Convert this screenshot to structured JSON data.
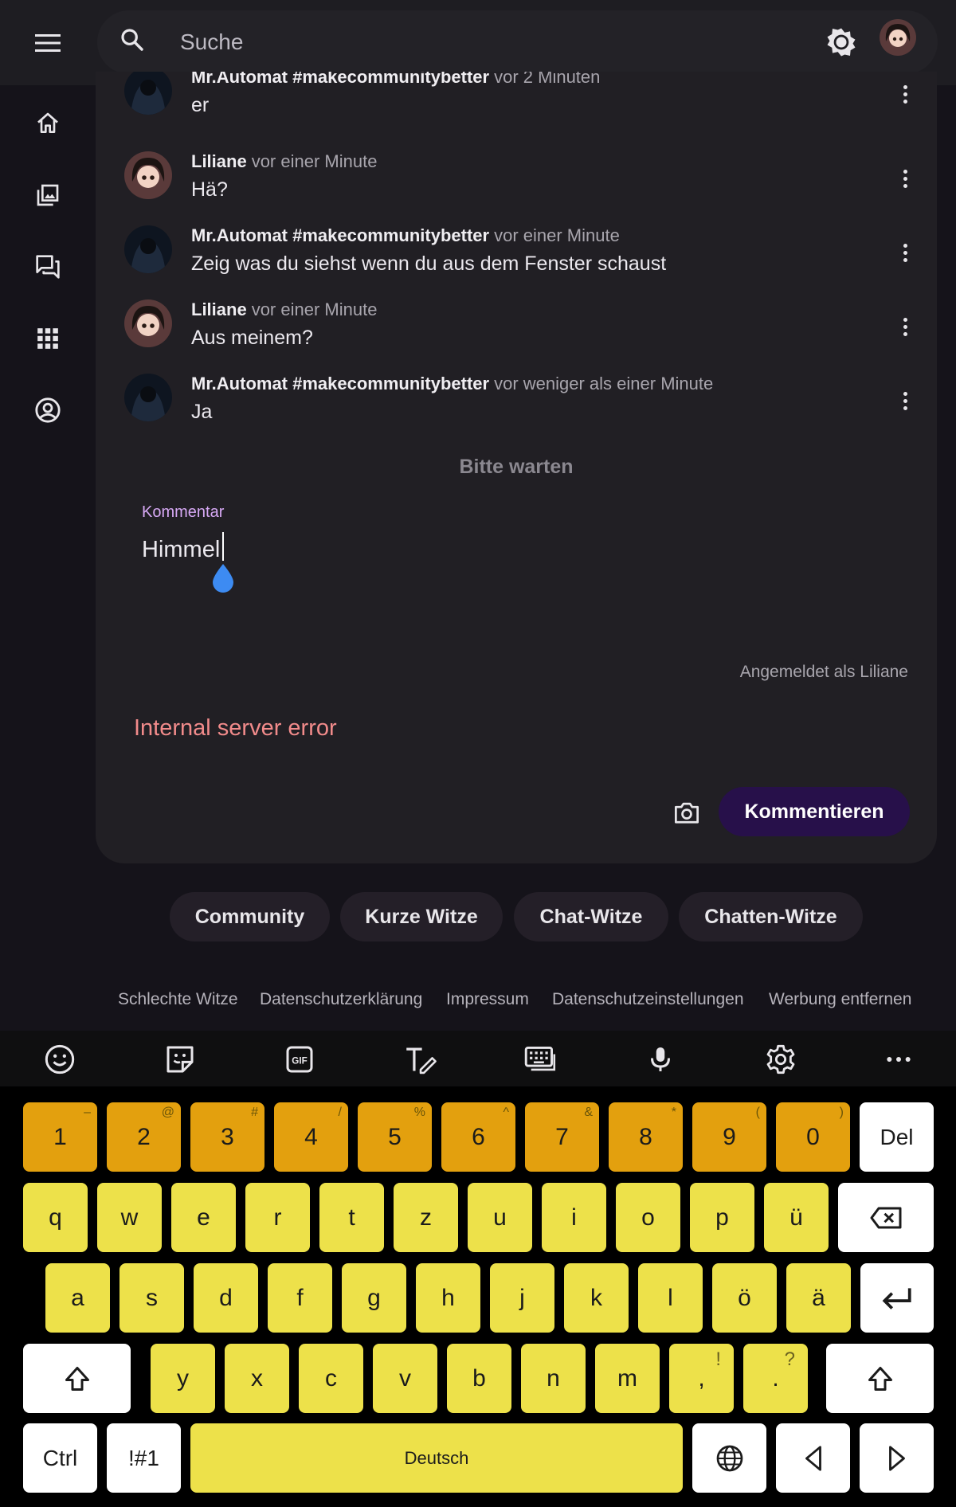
{
  "header": {
    "search_placeholder": "Suche"
  },
  "comments": [
    {
      "author": "Mr.Automat #makecommunitybetter",
      "time": "vor 2 Minuten",
      "text": "er"
    },
    {
      "author": "Liliane",
      "time": "vor einer Minute",
      "text": "Hä?"
    },
    {
      "author": "Mr.Automat #makecommunitybetter",
      "time": "vor einer Minute",
      "text": "Zeig was du siehst wenn du aus dem Fenster schaust"
    },
    {
      "author": "Liliane",
      "time": "vor einer Minute",
      "text": "Aus meinem?"
    },
    {
      "author": "Mr.Automat #makecommunitybetter",
      "time": "vor weniger als einer Minute",
      "text": "Ja"
    }
  ],
  "composer": {
    "status": "Bitte warten",
    "label": "Kommentar",
    "value": "Himmel",
    "signed_in": "Angemeldet als Liliane",
    "error": "Internal server error",
    "submit": "Kommentieren"
  },
  "chips": [
    "Community",
    "Kurze Witze",
    "Chat-Witze",
    "Chatten-Witze"
  ],
  "footer_links": [
    "Schlechte Witze",
    "Datenschutzerklärung",
    "Impressum",
    "Datenschutzeinstellungen",
    "Werbung entfernen"
  ],
  "keyboard": {
    "numbers": [
      "1",
      "2",
      "3",
      "4",
      "5",
      "6",
      "7",
      "8",
      "9",
      "0"
    ],
    "number_alts": [
      "–",
      "@",
      "#",
      "/",
      "%",
      "^",
      "&",
      "*",
      "(",
      ")"
    ],
    "del": "Del",
    "row1": [
      "q",
      "w",
      "e",
      "r",
      "t",
      "z",
      "u",
      "i",
      "o",
      "p",
      "ü"
    ],
    "row2": [
      "a",
      "s",
      "d",
      "f",
      "g",
      "h",
      "j",
      "k",
      "l",
      "ö",
      "ä"
    ],
    "row3": [
      "y",
      "x",
      "c",
      "v",
      "b",
      "n",
      "m",
      ",",
      "."
    ],
    "row3_alts": [
      "",
      "",
      "",
      "",
      "",
      "",
      "",
      "!",
      "?"
    ],
    "ctrl": "Ctrl",
    "symbols": "!#1",
    "space": "Deutsch"
  },
  "colors": {
    "accent": "#d7a9f5",
    "error": "#f28b8b",
    "submit_bg": "#27104a",
    "key_number": "#e3a00e",
    "key_letter": "#ede14a"
  }
}
